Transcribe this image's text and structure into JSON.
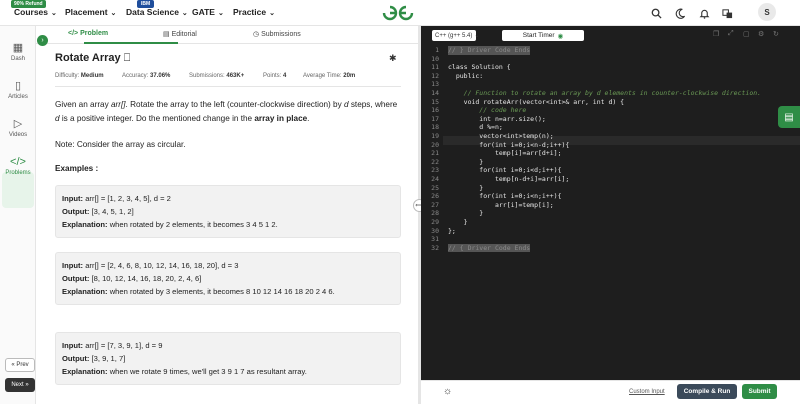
{
  "nav": {
    "refund_badge": "90% Refund",
    "ibm_badge": "IBM",
    "courses": "Courses",
    "placement": "Placement",
    "data_science": "Data Science",
    "gate": "GATE",
    "practice": "Practice",
    "avatar": "S",
    "brand_color": "#2f8d46"
  },
  "rail": {
    "dash": "Dash",
    "articles": "Articles",
    "videos": "Videos",
    "problems": "Problems",
    "prev": "« Prev",
    "next": "Next »"
  },
  "tabs": {
    "problem": "</> Problem",
    "editorial": "Editorial",
    "submissions": "Submissions"
  },
  "problem": {
    "title": "Rotate Array",
    "difficulty_label": "Difficulty:",
    "difficulty": "Medium",
    "accuracy_label": "Accuracy:",
    "accuracy": "37.06%",
    "submissions_label": "Submissions:",
    "submissions": "463K+",
    "points_label": "Points:",
    "points": "4",
    "avg_time_label": "Average Time:",
    "avg_time": "20m",
    "desc_1": "Given an array ",
    "desc_arr": "arr[]",
    "desc_2": ". Rotate the array to the left (counter-clockwise direction) by ",
    "desc_d": "d",
    "desc_3": " steps, where ",
    "desc_d2": "d",
    "desc_4": " is a positive integer. Do the mentioned change in the ",
    "desc_bold": "array in place",
    "desc_5": ".",
    "note": "Note: Consider the array as circular.",
    "examples_heading": "Examples :",
    "examples": [
      {
        "input_label": "Input:",
        "input": " arr[] = [1, 2, 3, 4, 5], d = 2",
        "output_label": "Output:",
        "output": " [3, 4, 5, 1, 2]",
        "explanation_label": "Explanation:",
        "explanation": " when rotated by 2 elements, it becomes 3 4 5 1 2."
      },
      {
        "input_label": "Input:",
        "input": " arr[] = [2, 4, 6, 8, 10, 12, 14, 16, 18, 20], d = 3",
        "output_label": "Output:",
        "output": " [8, 10, 12, 14, 16, 18, 20, 2, 4, 6]",
        "explanation_label": "Explanation:",
        "explanation": " when rotated by 3 elements, it becomes 8 10 12 14 16 18 20 2 4 6."
      },
      {
        "input_label": "Input:",
        "input": " arr[] = [7, 3, 9, 1], d = 9",
        "output_label": "Output:",
        "output": " [3, 9, 1, 7]",
        "explanation_label": "Explanation:",
        "explanation": " when we rotate 9 times, we'll get 3 9 1 7 as resultant array."
      }
    ]
  },
  "editor": {
    "language": "C++ (g++ 5.4)",
    "timer": "Start Timer",
    "custom_input": "Custom Input",
    "compile": "Compile & Run",
    "submit": "Submit",
    "lines": [
      {
        "n": "1",
        "text": "// } Driver Code Ends"
      },
      {
        "n": "10",
        "text": ""
      },
      {
        "n": "11",
        "text": "class Solution {"
      },
      {
        "n": "12",
        "text": "  public:"
      },
      {
        "n": "13",
        "text": ""
      },
      {
        "n": "14",
        "text": "    // Function to rotate an array by d elements in counter-clockwise direction."
      },
      {
        "n": "15",
        "text": "    void rotateArr(vector<int>& arr, int d) {"
      },
      {
        "n": "16",
        "text": "        // code here"
      },
      {
        "n": "17",
        "text": "        int n=arr.size();"
      },
      {
        "n": "18",
        "text": "        d %=n;"
      },
      {
        "n": "19",
        "text": "        vector<int>temp(n);"
      },
      {
        "n": "20",
        "text": "        for(int i=0;i<n-d;i++){"
      },
      {
        "n": "21",
        "text": "            temp[i]=arr[d+i];"
      },
      {
        "n": "22",
        "text": "        }"
      },
      {
        "n": "23",
        "text": "        for(int i=0;i<d;i++){"
      },
      {
        "n": "24",
        "text": "            temp[n-d+i]=arr[i];"
      },
      {
        "n": "25",
        "text": "        }"
      },
      {
        "n": "26",
        "text": "        for(int i=0;i<n;i++){"
      },
      {
        "n": "27",
        "text": "            arr[i]=temp[i];"
      },
      {
        "n": "28",
        "text": "        }"
      },
      {
        "n": "29",
        "text": "    }"
      },
      {
        "n": "30",
        "text": "};"
      },
      {
        "n": "31",
        "text": ""
      },
      {
        "n": "32",
        "text": "// { Driver Code Ends"
      }
    ]
  }
}
